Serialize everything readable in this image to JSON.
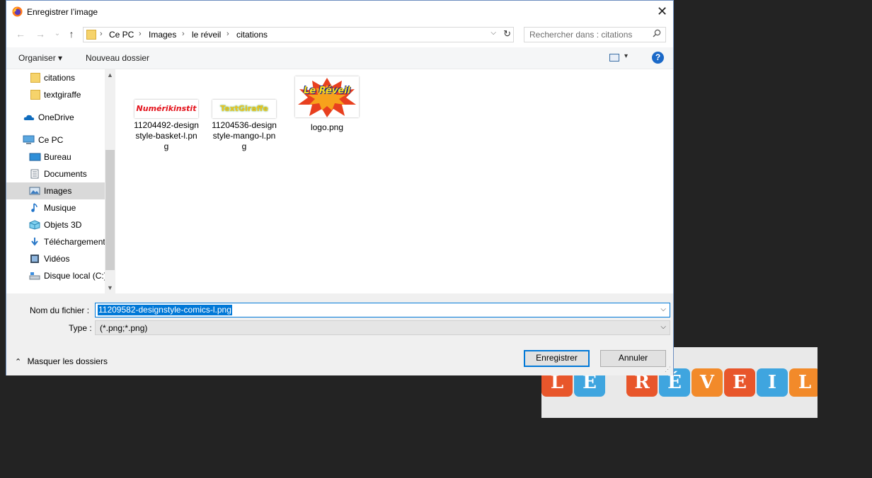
{
  "dialog": {
    "title": "Enregistrer l’image",
    "close_glyph": "✕"
  },
  "nav": {
    "back_glyph": "←",
    "forward_glyph": "→",
    "recent_glyph": "⌄",
    "up_glyph": "↑",
    "breadcrumb_sep": "›",
    "breadcrumbs": [
      "Ce PC",
      "Images",
      "le réveil",
      "citations"
    ],
    "address_dropdown_glyph": "⌵",
    "refresh_glyph": "↻",
    "search_placeholder": "Rechercher dans : citations"
  },
  "toolbar": {
    "organize": "Organiser ▾",
    "new_folder": "Nouveau dossier",
    "view_dropdown_glyph": "▾",
    "help": "?"
  },
  "sidebar": {
    "items": [
      {
        "label": "citations",
        "icon": "folder-icon"
      },
      {
        "label": "textgiraffe",
        "icon": "folder-icon"
      },
      {
        "label": "OneDrive",
        "icon": "onedrive-icon"
      },
      {
        "label": "Ce PC",
        "icon": "computer-icon"
      },
      {
        "label": "Bureau",
        "icon": "desktop-icon"
      },
      {
        "label": "Documents",
        "icon": "documents-icon"
      },
      {
        "label": "Images",
        "icon": "pictures-icon",
        "selected": true
      },
      {
        "label": "Musique",
        "icon": "music-icon"
      },
      {
        "label": "Objets 3D",
        "icon": "objects3d-icon"
      },
      {
        "label": "Téléchargement",
        "icon": "downloads-icon"
      },
      {
        "label": "Vidéos",
        "icon": "videos-icon"
      },
      {
        "label": "Disque local (C:)",
        "icon": "drive-icon"
      }
    ],
    "scroll_up": "▲",
    "scroll_down": "▼"
  },
  "files": [
    {
      "name": "11204492-designstyle-basket-l.png",
      "lines": [
        "11204492-design",
        "style-basket-l.pn",
        "g"
      ],
      "thumb_text": "Numérikinstit"
    },
    {
      "name": "11204536-designstyle-mango-l.png",
      "lines": [
        "11204536-design",
        "style-mango-l.pn",
        "g"
      ],
      "thumb_text": "TextGiraffe"
    },
    {
      "name": "logo.png",
      "lines": [
        "logo.png"
      ],
      "thumb_text": "Le Réveil"
    }
  ],
  "form": {
    "filename_label": "Nom du fichier :",
    "filename_value": "11209582-designstyle-comics-l.png",
    "type_label": "Type :",
    "type_value": "(*.png;*.png)",
    "dropdown_glyph": "⌵",
    "hide_folders_glyph": "⌃",
    "hide_folders": "Masquer les dossiers",
    "save": "Enregistrer",
    "cancel": "Annuler",
    "grip_glyph": "⋰"
  },
  "background_preview": {
    "letters": [
      "L",
      "E",
      "R",
      "É",
      "V",
      "E",
      "I",
      "L"
    ]
  },
  "colors": {
    "selection": "#0078d7",
    "folder": "#f6d36b",
    "tile_orange": "#f28a2a",
    "tile_blue": "#3fa5df",
    "tile_red": "#e8562b"
  }
}
